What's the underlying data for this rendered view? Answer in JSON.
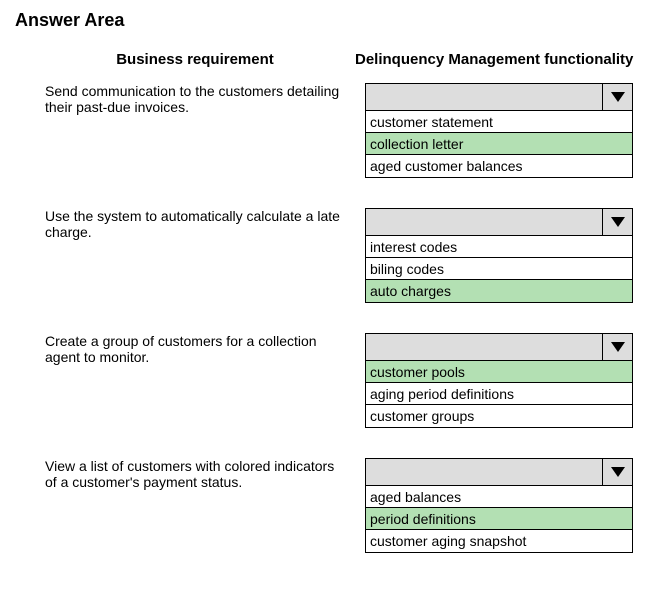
{
  "title": "Answer Area",
  "headers": {
    "left": "Business requirement",
    "right": "Delinquency Management functionality"
  },
  "rows": [
    {
      "requirement": "Send communication to the customers detailing their past-due invoices.",
      "options": [
        {
          "label": "customer statement",
          "highlighted": false
        },
        {
          "label": "collection letter",
          "highlighted": true
        },
        {
          "label": "aged customer balances",
          "highlighted": false
        }
      ]
    },
    {
      "requirement": "Use the system to automatically calculate a late charge.",
      "options": [
        {
          "label": "interest codes",
          "highlighted": false
        },
        {
          "label": "biling codes",
          "highlighted": false
        },
        {
          "label": "auto charges",
          "highlighted": true
        }
      ]
    },
    {
      "requirement": "Create a group of customers for a collection agent to monitor.",
      "options": [
        {
          "label": "customer pools",
          "highlighted": true
        },
        {
          "label": "aging period definitions",
          "highlighted": false
        },
        {
          "label": "customer groups",
          "highlighted": false
        }
      ]
    },
    {
      "requirement": "View a list of customers with colored indicators of a customer's payment status.",
      "options": [
        {
          "label": "aged balances",
          "highlighted": false
        },
        {
          "label": "period definitions",
          "highlighted": true
        },
        {
          "label": "customer aging snapshot",
          "highlighted": false
        }
      ]
    }
  ]
}
